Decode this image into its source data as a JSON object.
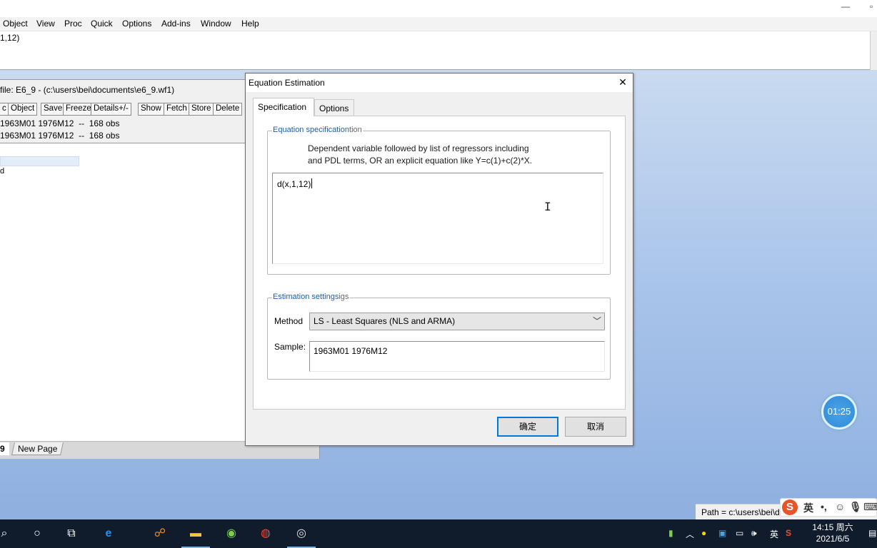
{
  "app": {
    "menu": [
      "Object",
      "View",
      "Proc",
      "Quick",
      "Options",
      "Add-ins",
      "Window",
      "Help"
    ],
    "command_text": "1,12)"
  },
  "workfile": {
    "title": "file: E6_9 - (c:\\users\\bei\\documents\\e6_9.wf1)",
    "toolbar": [
      "c",
      "Object",
      "Save",
      "Freeze",
      "Details+/-",
      "Show",
      "Fetch",
      "Store",
      "Delete"
    ],
    "range_line": "1963M01 1976M12  --  168 obs",
    "sample_line": "1963M01 1976M12  --  168 obs",
    "list_fragment": "d",
    "tabs": {
      "current": "9",
      "new_page": "New Page"
    }
  },
  "dialog": {
    "title": "Equation Estimation",
    "tabs": [
      "Specification",
      "Options"
    ],
    "spec_group": {
      "legend": "Equation specification",
      "legend_ghost": "tion"
    },
    "description": "Dependent variable followed by list of regressors including\nand PDL terms, OR an explicit equation like Y=c(1)+c(2)*X.",
    "equation_value": "d(x,1,12)",
    "settings_group": {
      "legend": "Estimation settings",
      "legend_ghost": "igs"
    },
    "method_label": "Method",
    "method_value": "LS  -  Least Squares (NLS and ARMA)",
    "sample_label": "Sample:",
    "sample_value": "1963M01 1976M12",
    "ok_label": "确定",
    "cancel_label": "取消"
  },
  "status": {
    "path": "Path = c:\\users\\bei\\do"
  },
  "timer": "01:25",
  "ime": {
    "lang": "英"
  },
  "tray": {
    "lang": "英",
    "time": "14:15 周六",
    "date": "2021/6/5"
  },
  "colors": {
    "accent": "#0078d7",
    "legend": "#1f5fa6",
    "taskbar": "#101c2c"
  }
}
